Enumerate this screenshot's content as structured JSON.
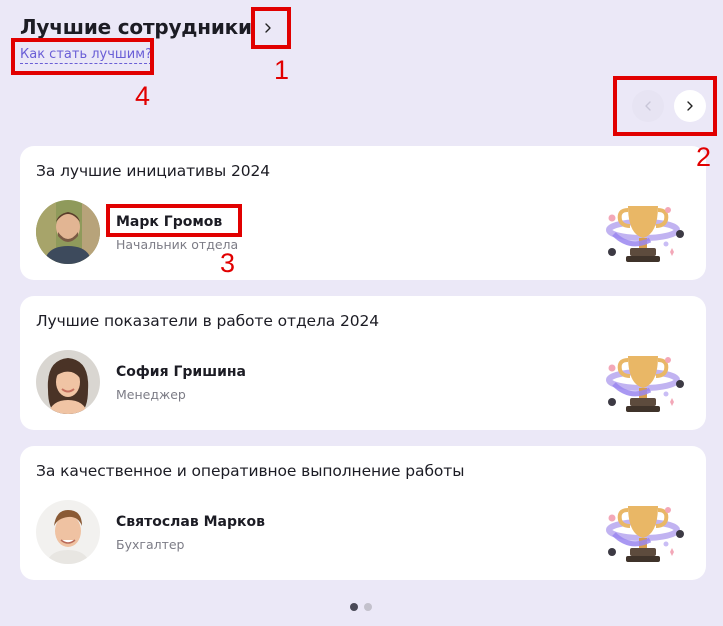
{
  "header": {
    "title": "Лучшие сотрудники",
    "help_link": "Как стать лучшим?"
  },
  "icons": {
    "title_chevron": "chevron-right-icon",
    "prev": "chevron-left-icon",
    "next": "chevron-right-icon"
  },
  "annotations": [
    "1",
    "2",
    "3",
    "4"
  ],
  "cards": [
    {
      "award": "За лучшие инициативы 2024",
      "name": "Марк Громов",
      "role": "Начальник отдела"
    },
    {
      "award": "Лучшие показатели в работе отдела 2024",
      "name": "София Гришина",
      "role": "Менеджер"
    },
    {
      "award": "За качественное и оперативное выполнение работы",
      "name": "Святослав Марков",
      "role": "Бухгалтер"
    }
  ],
  "pagination": {
    "pages": 2,
    "active": 1
  },
  "colors": {
    "accent": "#6a5ed6",
    "annotation": "#e10000",
    "background": "#ebe8f7"
  }
}
